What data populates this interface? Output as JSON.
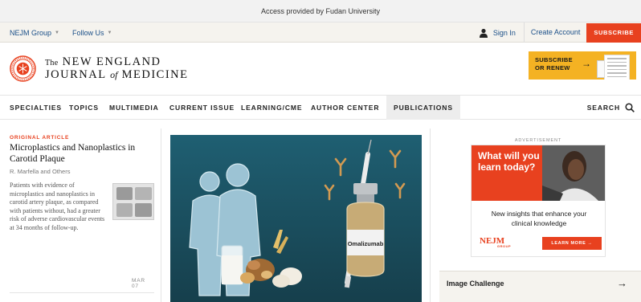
{
  "access_bar": {
    "text": "Access provided by Fudan University"
  },
  "utility": {
    "nejm_group": "NEJM Group",
    "follow_us": "Follow Us",
    "sign_in": "Sign In",
    "create_account": "Create Account",
    "subscribe": "SUBSCRIBE"
  },
  "header": {
    "logo_the": "The",
    "logo_line1": "NEW ENGLAND",
    "logo_journal": "JOURNAL",
    "logo_of": "of",
    "logo_medicine": "MEDICINE",
    "promo_line1": "SUBSCRIBE",
    "promo_line2": "OR RENEW"
  },
  "nav": {
    "items": [
      "SPECIALTIES",
      "TOPICS",
      "MULTIMEDIA",
      "CURRENT ISSUE",
      "LEARNING/CME",
      "AUTHOR CENTER",
      "PUBLICATIONS"
    ],
    "search": "SEARCH"
  },
  "article": {
    "label": "ORIGINAL ARTICLE",
    "title": "Microplastics and Nanoplastics in Carotid Plaque",
    "authors": "R. Marfella and Others",
    "summary": "Patients with evidence of microplastics and nanoplastics in carotid artery plaque, as compared with patients without, had a greater risk of adverse cardiovascular events at 34 months of follow-up.",
    "date": "MAR 07"
  },
  "hero": {
    "vial_label": "Omalizumab"
  },
  "ad": {
    "label": "ADVERTISEMENT",
    "headline": "What will you learn today?",
    "subtext": "New insights that enhance your clinical knowledge",
    "logo": "NEJM",
    "logo_sub": "GROUP",
    "button": "LEARN MORE →"
  },
  "image_challenge": {
    "label": "Image Challenge"
  },
  "colors": {
    "brand_red": "#e8411f",
    "promo_gold": "#f4b223",
    "hero_teal": "#1f5c6e",
    "link_blue": "#1a4f88"
  }
}
